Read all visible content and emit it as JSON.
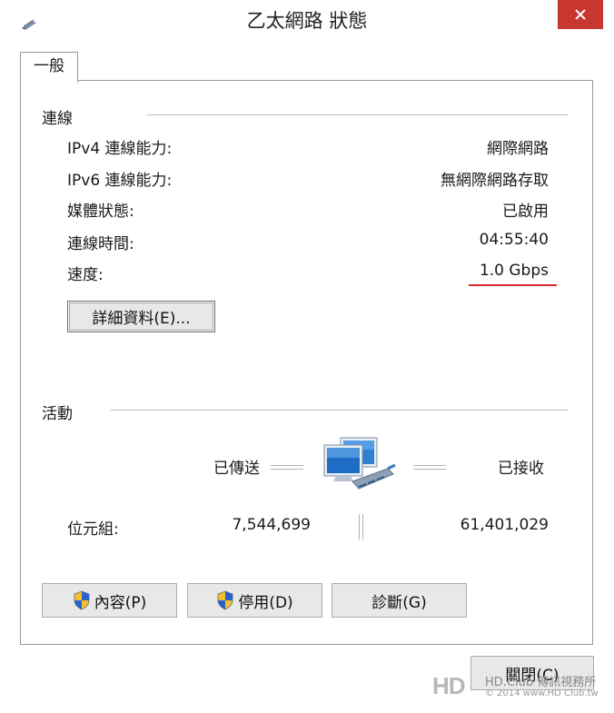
{
  "window": {
    "title": "乙太網路 狀態",
    "close_icon": "close-icon",
    "app_icon": "network-adapter-icon"
  },
  "tabs": [
    {
      "label": "一般"
    }
  ],
  "connection": {
    "section_title": "連線",
    "rows": [
      {
        "label": "IPv4 連線能力:",
        "value": "網際網路"
      },
      {
        "label": "IPv6 連線能力:",
        "value": "無網際網路存取"
      },
      {
        "label": "媒體狀態:",
        "value": "已啟用"
      },
      {
        "label": "連線時間:",
        "value": "04:55:40"
      },
      {
        "label": "速度:",
        "value": "1.0 Gbps"
      }
    ],
    "details_button": "詳細資料(E)...",
    "highlight_color": "#d8262a"
  },
  "activity": {
    "section_title": "活動",
    "sent_label": "已傳送",
    "received_label": "已接收",
    "bytes_label": "位元組:",
    "bytes_sent": "7,544,699",
    "bytes_received": "61,401,029",
    "icon": "network-activity-icon"
  },
  "buttons": {
    "properties": "內容(P)",
    "disable": "停用(D)",
    "diagnose": "診斷(G)",
    "close": "關閉(C)",
    "shield_icon": "uac-shield-icon"
  },
  "watermark": {
    "logo": "HD",
    "text": "HD.Club 傳訊視務所",
    "sub": "© 2014 www.HD Club.tw"
  }
}
